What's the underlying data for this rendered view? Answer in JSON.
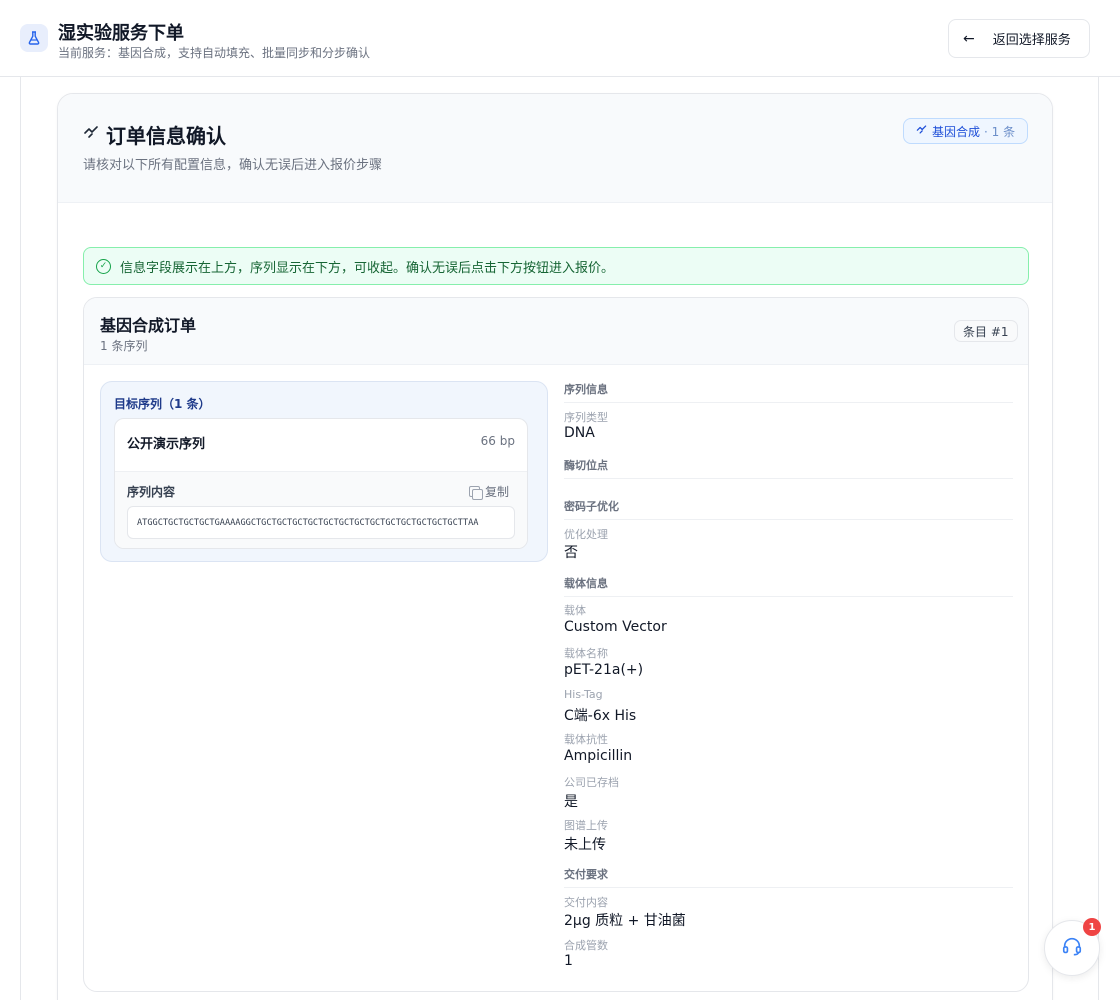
{
  "header": {
    "title": "湿实验服务下单",
    "subtitle": "当前服务：基因合成，支持自动填充、批量同步和分步确认",
    "back_label": "返回选择服务"
  },
  "confirm": {
    "title": "订单信息确认",
    "description": "请核对以下所有配置信息，确认无误后进入报价步骤",
    "badge_service": "基因合成",
    "badge_count": "· 1 条"
  },
  "alert": {
    "text": "信息字段展示在上方，序列显示在下方，可收起。确认无误后点击下方按钮进入报价。"
  },
  "order": {
    "title": "基因合成订单",
    "count": "1 条序列",
    "item_tag": "条目 #1",
    "sequences_title": "目标序列（1 条）",
    "sequence": {
      "name": "公开演示序列",
      "length": "66 bp",
      "content_label": "序列内容",
      "copy_label": "复制",
      "content": "ATGGCTGCTGCTGCTGAAAAGGCTGCTGCTGCTGCTGCTGCTGCTGCTGCTGCTGCTGCTGCTTAA"
    },
    "details": {
      "sec_sequence": "序列信息",
      "seq_type_label": "序列类型",
      "seq_type_value": "DNA",
      "sec_cut": "酶切位点",
      "sec_codon": "密码子优化",
      "opt_label": "优化处理",
      "opt_value": "否",
      "sec_vector": "载体信息",
      "vector_label": "载体",
      "vector_value": "Custom Vector",
      "vector_name_label": "载体名称",
      "vector_name_value": "pET-21a(+)",
      "his_label": "His-Tag",
      "his_value": "C端-6x His",
      "resist_label": "载体抗性",
      "resist_value": "Ampicillin",
      "archived_label": "公司已存档",
      "archived_value": "是",
      "map_label": "图谱上传",
      "map_value": "未上传",
      "sec_delivery": "交付要求",
      "delivery_label": "交付内容",
      "delivery_value": "2μg 质粒 + 甘油菌",
      "tubes_label": "合成管数",
      "tubes_value": "1"
    }
  },
  "help": {
    "badge": "1"
  },
  "colors": {
    "accent": "#2563eb",
    "success": "#16a34a",
    "danger": "#ef4444"
  }
}
